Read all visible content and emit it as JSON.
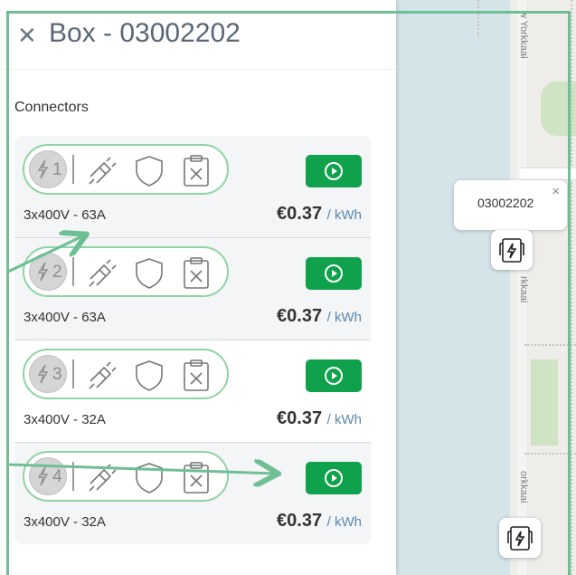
{
  "panel": {
    "title": "Box - 03002202",
    "close_icon": "close-icon",
    "section_label": "Connectors"
  },
  "connectors": [
    {
      "number": "1",
      "spec": "3x400V - 63A",
      "price": "€0.37",
      "unit": "/ kWh"
    },
    {
      "number": "2",
      "spec": "3x400V - 63A",
      "price": "€0.37",
      "unit": "/ kWh"
    },
    {
      "number": "3",
      "spec": "3x400V - 32A",
      "price": "€0.37",
      "unit": "/ kWh"
    },
    {
      "number": "4",
      "spec": "3x400V - 32A",
      "price": "€0.37",
      "unit": "/ kWh"
    }
  ],
  "map": {
    "popup_label": "03002202",
    "popup_close": "×",
    "road_label_top": "w Yorkkaai",
    "road_label_mid": "rkkaai",
    "road_label_bottom": "orkkaai"
  },
  "colors": {
    "accent_green": "#0fa14c",
    "pill_border": "#8fd4a4",
    "annotation": "#6fbf94",
    "unit_blue": "#5b88b0"
  }
}
